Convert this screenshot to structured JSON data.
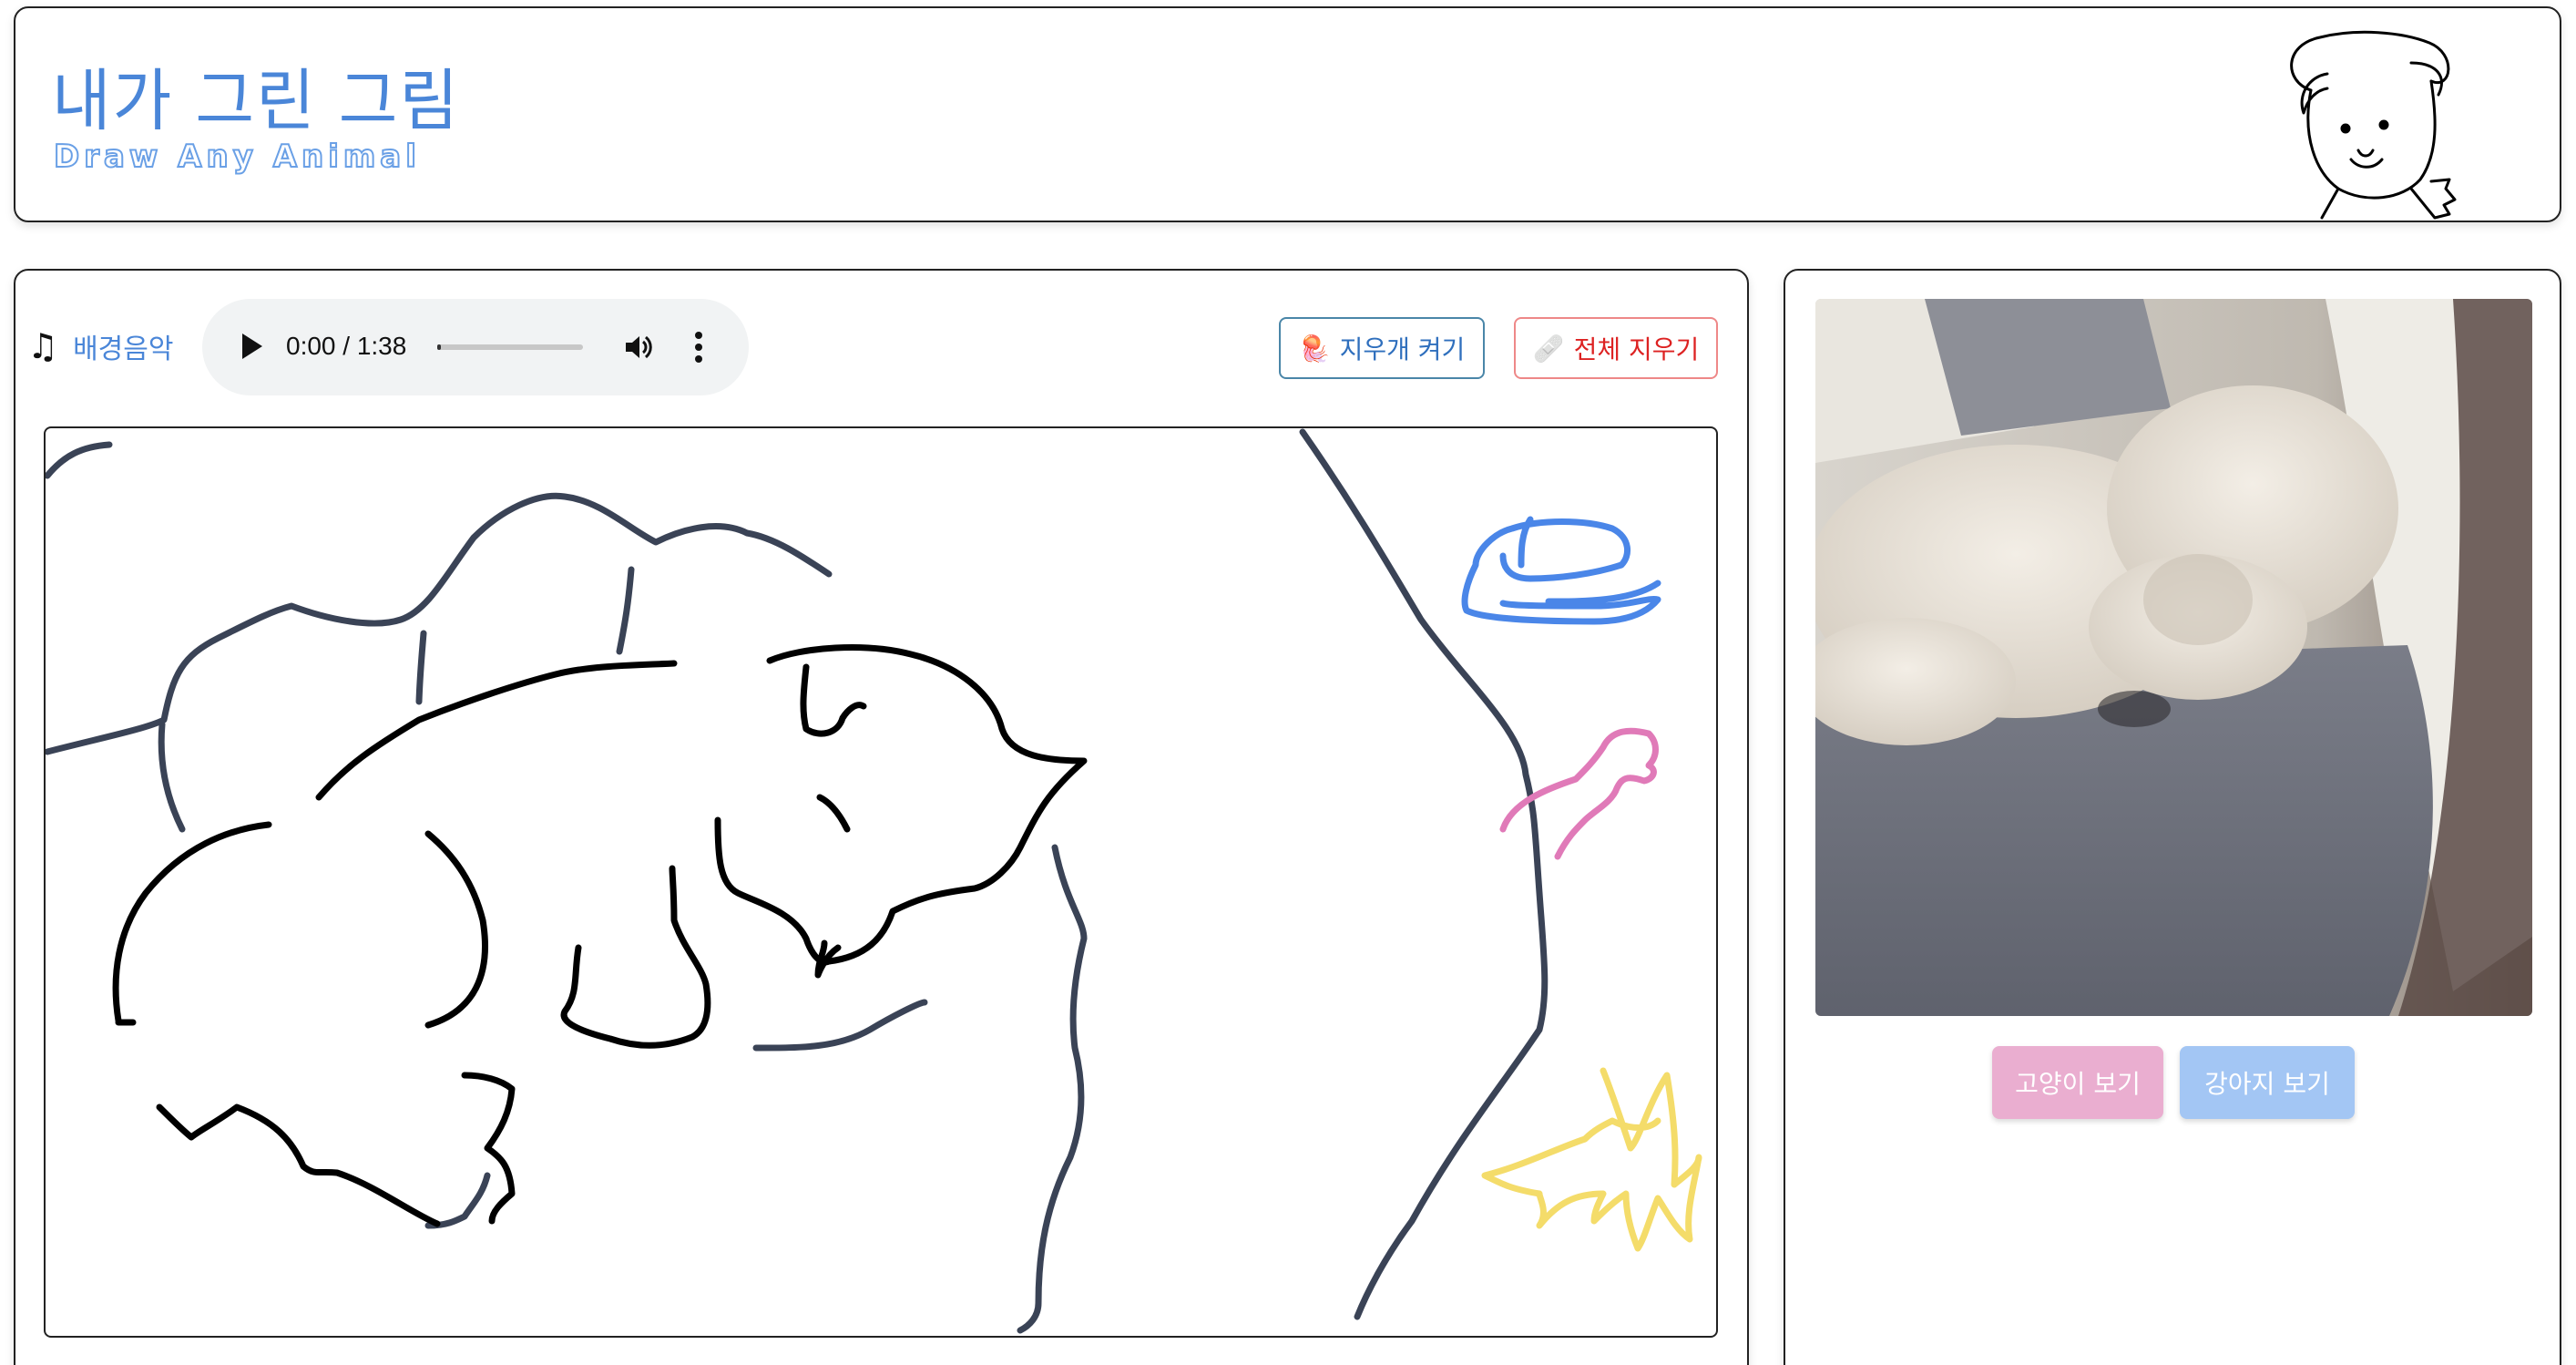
{
  "header": {
    "title": "내가 그린 그림",
    "subtitle": "Draw Any Animal",
    "mascot_icon": "puppy-doodle-icon"
  },
  "toolbar": {
    "music_icon": "music-note-icon",
    "music_label": "배경음악",
    "audio": {
      "time": "0:00 / 1:38",
      "progress": 0,
      "play_icon": "play-icon",
      "volume_icon": "volume-icon",
      "more_icon": "more-vertical-icon"
    },
    "eraser_button": "지우개 켜기",
    "eraser_icon": "jellyfish-icon",
    "clear_button": "전체 지우기",
    "clear_icon": "eraser-icon"
  },
  "canvas": {
    "stroke_colors": {
      "navy": "#3a4356",
      "black": "#000000",
      "blue": "#4a86e8",
      "pink": "#e07ab8",
      "yellow": "#f4dc6a"
    }
  },
  "side": {
    "photo_subject": "sleeping-white-poodle-on-gray-sofa",
    "cat_button": "고양이 보기",
    "dog_button": "강아지 보기",
    "colors": {
      "cat": "#eaaed0",
      "dog": "#a3c6f4"
    }
  }
}
